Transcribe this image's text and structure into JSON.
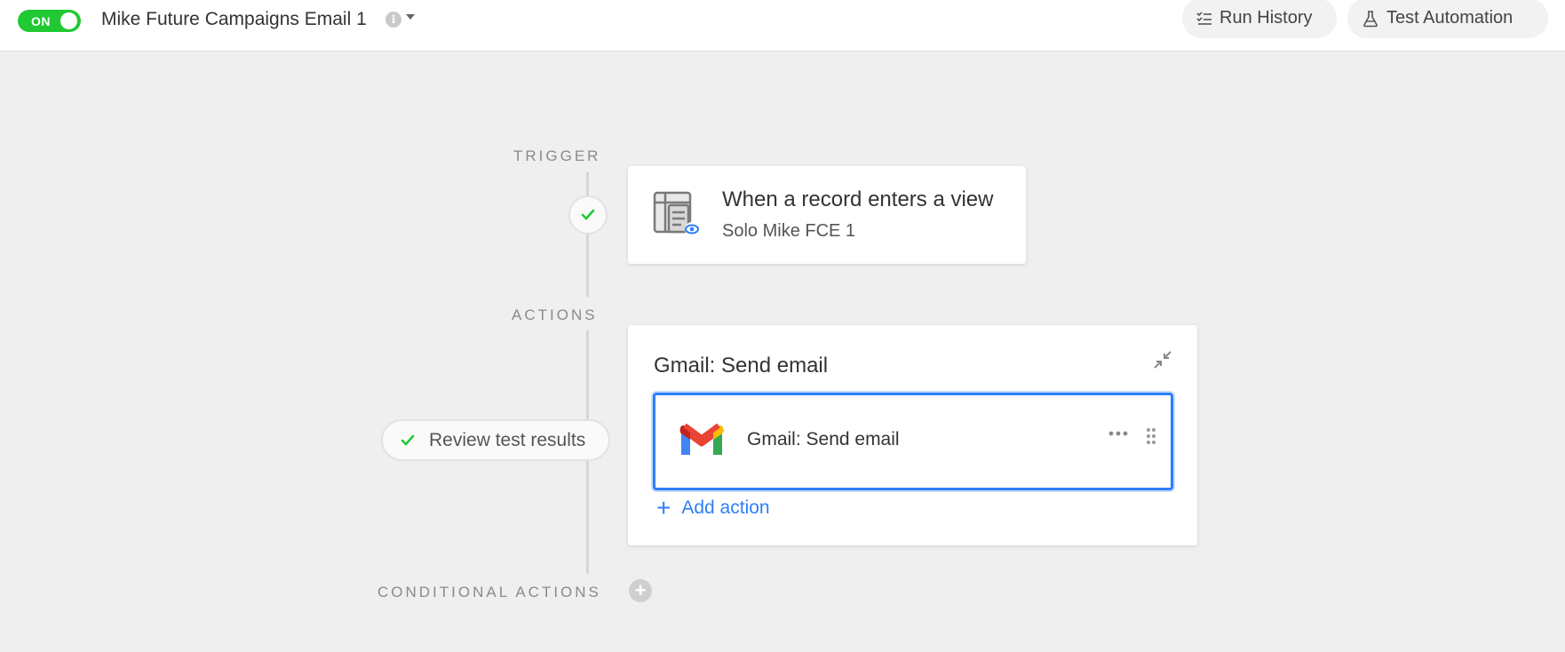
{
  "header": {
    "toggle_label": "ON",
    "automation_title": "Mike Future Campaigns Email 1",
    "info_icon": "info-icon",
    "buttons": {
      "run_history": "Run History",
      "test_automation": "Test Automation"
    }
  },
  "trigger": {
    "section_label": "TRIGGER",
    "title": "When a record enters a view",
    "subtitle": "Solo Mike FCE 1",
    "status_icon": "check-icon"
  },
  "actions": {
    "section_label": "ACTIONS",
    "group_title": "Gmail: Send email",
    "items": [
      {
        "label": "Gmail: Send email",
        "icon": "gmail-icon"
      }
    ],
    "add_action_label": "Add action",
    "review_label": "Review test results"
  },
  "conditional": {
    "section_label": "CONDITIONAL ACTIONS"
  },
  "colors": {
    "toggle_on": "#20c933",
    "accent_blue": "#2d7ff9",
    "background": "#efefef"
  }
}
